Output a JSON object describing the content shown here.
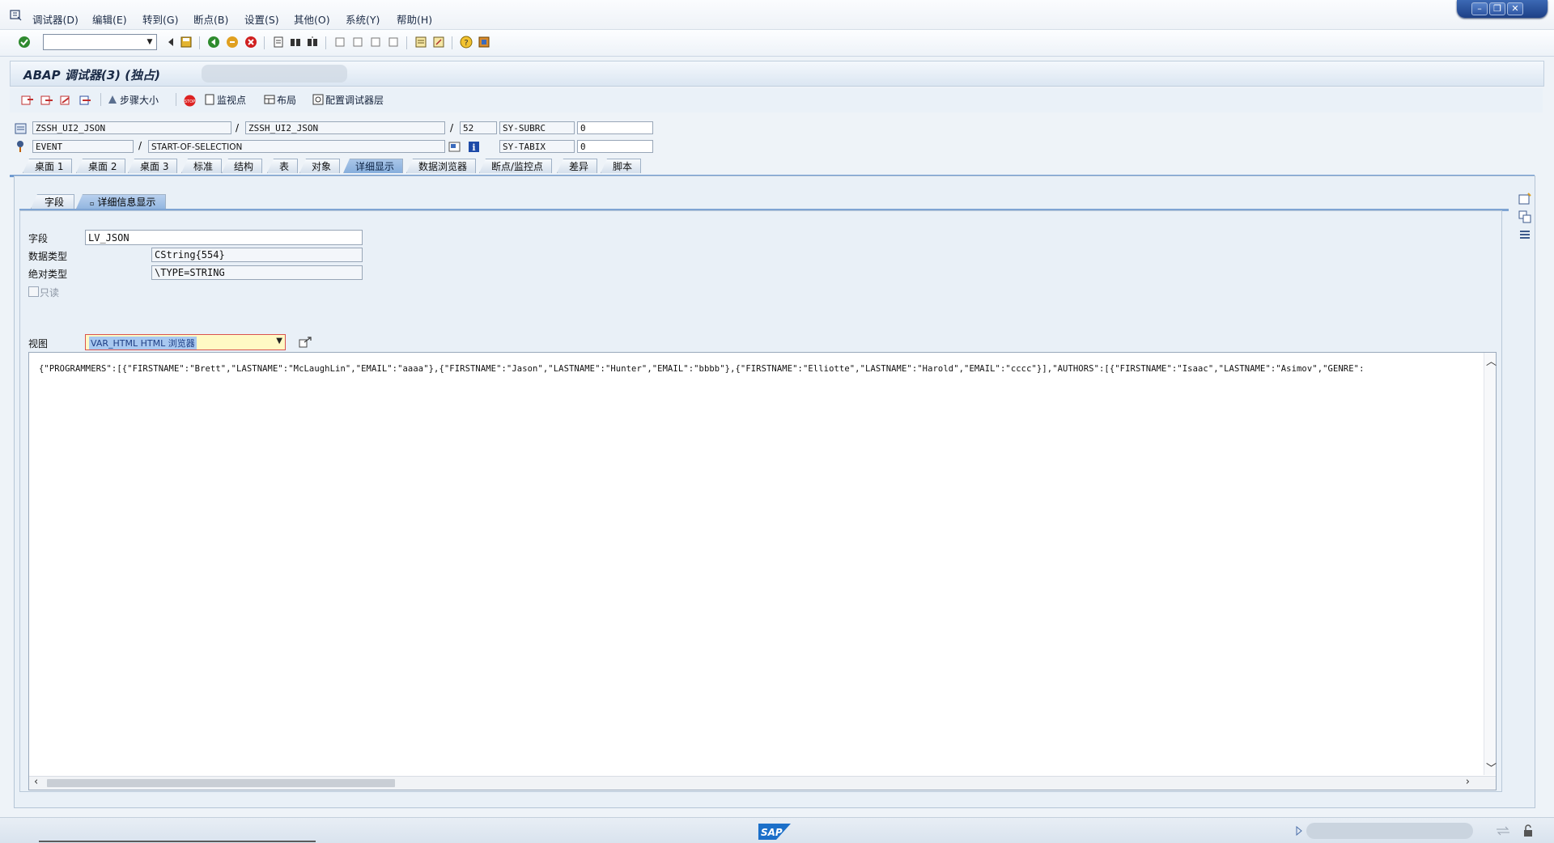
{
  "menu": [
    "调试器(D)",
    "编辑(E)",
    "转到(G)",
    "断点(B)",
    "设置(S)",
    "其他(O)",
    "系统(Y)",
    "帮助(H)"
  ],
  "title": "ABAP 调试器(3) (独占)",
  "app_toolbar": {
    "step_size": "步骤大小",
    "watchpoint": "监视点",
    "layout": "布局",
    "configure_layer": "配置调试器层"
  },
  "header": {
    "program": "ZSSH_UI2_JSON",
    "include": "ZSSH_UI2_JSON",
    "line": "52",
    "event_type": "EVENT",
    "event": "START-OF-SELECTION",
    "sysvar1_name": "SY-SUBRC",
    "sysvar1_value": "0",
    "sysvar2_name": "SY-TABIX",
    "sysvar2_value": "0"
  },
  "main_tabs": [
    "桌面 1",
    "桌面 2",
    "桌面 3",
    "标准",
    "结构",
    "表",
    "对象",
    "详细显示",
    "数据浏览器",
    "断点/监控点",
    "差异",
    "脚本"
  ],
  "main_tab_active": "详细显示",
  "sub_tabs": [
    "字段",
    "详细信息显示"
  ],
  "sub_tab_active": "详细信息显示",
  "detail": {
    "field_label": "字段",
    "field_value": "LV_JSON",
    "datatype_label": "数据类型",
    "datatype_value": "CString{554}",
    "abstype_label": "绝对类型",
    "abstype_value": "\\TYPE=STRING",
    "readonly_label": "只读",
    "view_label": "视图",
    "view_value": "VAR_HTML HTML 浏览器"
  },
  "json_text": "{\"PROGRAMMERS\":[{\"FIRSTNAME\":\"Brett\",\"LASTNAME\":\"McLaughLin\",\"EMAIL\":\"aaaa\"},{\"FIRSTNAME\":\"Jason\",\"LASTNAME\":\"Hunter\",\"EMAIL\":\"bbbb\"},{\"FIRSTNAME\":\"Elliotte\",\"LASTNAME\":\"Harold\",\"EMAIL\":\"cccc\"}],\"AUTHORS\":[{\"FIRSTNAME\":\"Isaac\",\"LASTNAME\":\"Asimov\",\"GENRE\":",
  "status": {
    "logo_text": "SAP"
  },
  "colors": {
    "accent": "#6f9bd1",
    "active_tab": "#93b6e0",
    "title_bg": "#dbe6f2"
  }
}
